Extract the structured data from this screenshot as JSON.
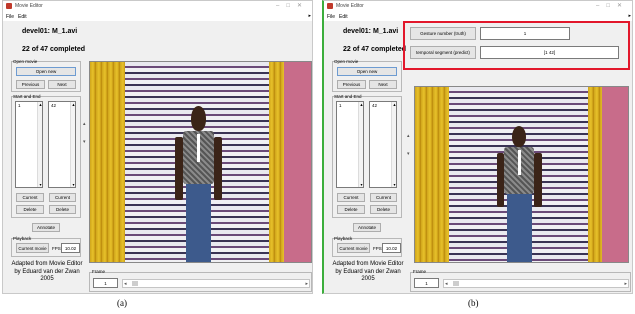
{
  "window": {
    "title": "Movie Editor",
    "menu": [
      "File",
      "Edit"
    ],
    "controls": [
      "–",
      "□",
      "✕"
    ],
    "menu_arrow": "▸"
  },
  "header": {
    "movie_name": "devel01: M_1.avi",
    "progress_text": "22 of 47 completed",
    "progress_completed": 22,
    "progress_total": 47
  },
  "open_movie": {
    "label": "Open movie",
    "open_new": "Open new",
    "previous": "Previous",
    "next": "Next"
  },
  "start_end": {
    "label": "Start and End",
    "start_list": [
      "1"
    ],
    "end_list": [
      "42"
    ],
    "current_left": "Current",
    "current_right": "Current",
    "delete_left": "Delete",
    "delete_right": "Delete"
  },
  "annotate": "Annotate",
  "playback": {
    "label": "Playback",
    "current_movie": "Current movie",
    "fps_label": "FPS",
    "fps_value": "10.02"
  },
  "credit": {
    "line1": "Adapted from Movie Editor",
    "line2": "by Eduard van der Zwan",
    "line3": "2005"
  },
  "frame": {
    "label": "Frame",
    "value": "1"
  },
  "scroll": {
    "left": "◂",
    "right": "▸",
    "v_up": "▴",
    "v_dn": "▾",
    "list_up": "▲",
    "list_dn": "▾"
  },
  "gesture": {
    "gesture_button": "Gesture number (truth)",
    "gesture_value": "1",
    "segment_button": "temporal segment (predict)",
    "segment_value": "[1 42]"
  },
  "captions": {
    "a": "(a)",
    "b": "(b)"
  },
  "colors": {
    "highlight": "#e2172b",
    "window_bg": "#f0f0f0",
    "active_border": "#3cae3c"
  },
  "icons": {
    "app": "movie-editor-icon",
    "video": "video-frame"
  }
}
